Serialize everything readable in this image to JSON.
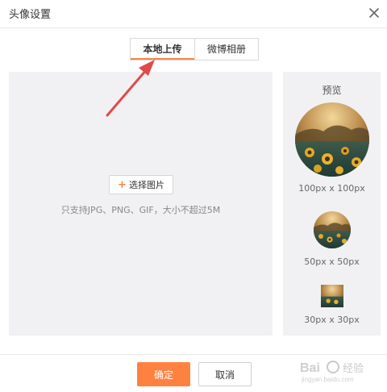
{
  "dialog": {
    "title": "头像设置",
    "close_icon": "close-icon"
  },
  "tabs": [
    {
      "label": "本地上传",
      "active": true
    },
    {
      "label": "微博相册",
      "active": false
    }
  ],
  "upload": {
    "choose_label": "选择图片",
    "hint": "只支持JPG、PNG、GIF，大小不超过5M"
  },
  "preview": {
    "title": "预览",
    "sizes": [
      "100px x 100px",
      "50px x 50px",
      "30px x 30px"
    ]
  },
  "footer": {
    "confirm_label": "确定",
    "cancel_label": "取消"
  },
  "colors": {
    "accent": "#ff8140",
    "annotation_arrow": "#e04a4a",
    "panel_bg": "#f1f1f3"
  },
  "watermark": {
    "text": "Bai 经验",
    "sub": "jingyan.baidu.com"
  }
}
